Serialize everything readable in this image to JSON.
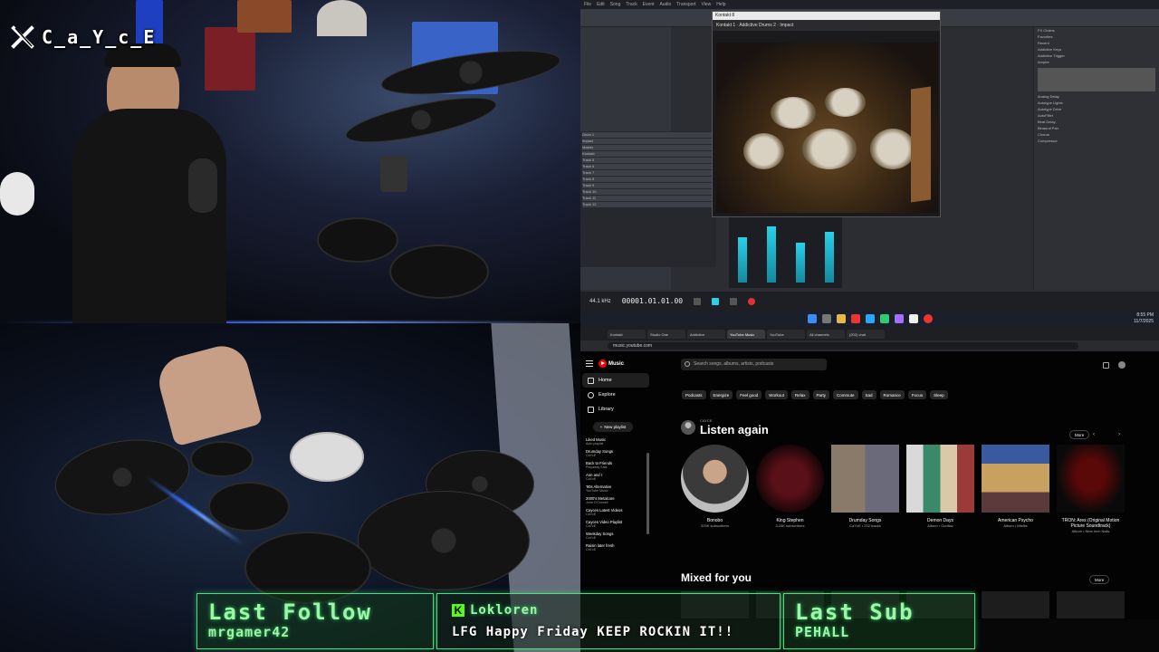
{
  "streamer": {
    "handle": "C_a_Y_c_E"
  },
  "daw": {
    "menu": [
      "File",
      "Edit",
      "Song",
      "Track",
      "Event",
      "Audio",
      "Transport",
      "View",
      "Help"
    ],
    "kontakt_title": "Kontakt 8",
    "kontakt_tabs": [
      "Kontakt 1",
      "Addictive Drums 2",
      "Impact"
    ],
    "track_names": [
      "Drum 1",
      "Impact",
      "Master",
      "Kontakt",
      "Track 5",
      "Track 6",
      "Track 7",
      "Track 8",
      "Track 9",
      "Track 10",
      "Track 11",
      "Track 12"
    ],
    "browser_items": [
      "FX Chains",
      "Favorites",
      "Recent",
      "Addictive Keys",
      "Addictive Trigger",
      "Ampire",
      "Analog Delay",
      "Autotype Lights",
      "Autotype Drive",
      "AutoFilter",
      "Beat Delay",
      "Binaural Pan",
      "Chorus",
      "Compressor"
    ],
    "timecode": "00001.01.01.00",
    "sample_rate": "44.1 kHz"
  },
  "taskbar": {
    "time": "8:55 PM",
    "date": "11/7/2025"
  },
  "browser": {
    "tabs": [
      "Kontakt",
      "Studio One",
      "Addictive",
      "YouTube Music",
      "YouTube",
      "All channels",
      "(202) chat"
    ],
    "url": "music.youtube.com"
  },
  "ytmusic": {
    "logo": "Music",
    "search_placeholder": "Search songs, albums, artists, podcasts",
    "nav": [
      {
        "label": "Home",
        "active": true
      },
      {
        "label": "Explore",
        "active": false
      },
      {
        "label": "Library",
        "active": false
      }
    ],
    "new_playlist": "New playlist",
    "playlists": [
      {
        "name": "Liked Music",
        "sub": "Auto playlist"
      },
      {
        "name": "Drumday Songs",
        "sub": "CaYcE"
      },
      {
        "name": "Back to Friends",
        "sub": "Playarray Sala"
      },
      {
        "name": "Aon and I",
        "sub": "CaYcE"
      },
      {
        "name": "'90s Alternative",
        "sub": "YouTube Music"
      },
      {
        "name": "2000's Metalcore",
        "sub": "John O'Connell"
      },
      {
        "name": "Cayces Latest Videos",
        "sub": "CaYcE"
      },
      {
        "name": "Cayces Video Playlist",
        "sub": "CaYcE"
      },
      {
        "name": "Weekday Songs",
        "sub": "CaYcE"
      },
      {
        "name": "Raisin later fresh",
        "sub": "CaYcE"
      }
    ],
    "chips": [
      "Podcasts",
      "Energize",
      "Feel good",
      "Workout",
      "Relax",
      "Party",
      "Commute",
      "Sad",
      "Romance",
      "Focus",
      "Sleep"
    ],
    "listen_again": {
      "user": "CAYCE",
      "title": "Listen again",
      "more": "More"
    },
    "cards": [
      {
        "title": "Bonobo",
        "sub": "325K subscribers"
      },
      {
        "title": "King Stephen",
        "sub": "3.24K subscribers"
      },
      {
        "title": "Drumday Songs",
        "sub": "CaYcE • 232 tracks"
      },
      {
        "title": "Demon Days",
        "sub": "Album • Gorillaz"
      },
      {
        "title": "American Psycho",
        "sub": "Album • Misfits"
      },
      {
        "title": "TRON: Ares (Original Motion Picture Soundtrack)",
        "sub": "Album • Nine Inch Nails"
      }
    ],
    "mixed": {
      "title": "Mixed for you",
      "more": "More"
    }
  },
  "overlays": {
    "last_follow_label": "Last Follow",
    "last_follow_name": "mrgamer42",
    "chat_user": "Lokloren",
    "chat_message": "LFG Happy Friday KEEP ROCKIN IT!!",
    "last_sub_label": "Last Sub",
    "last_sub_name": "PEHALL"
  },
  "colors": {
    "accent_green": "#9ef5a8",
    "yt_red": "#ff0000",
    "daw_cyan": "#2bd0e8",
    "kick_green": "#53fc18"
  }
}
